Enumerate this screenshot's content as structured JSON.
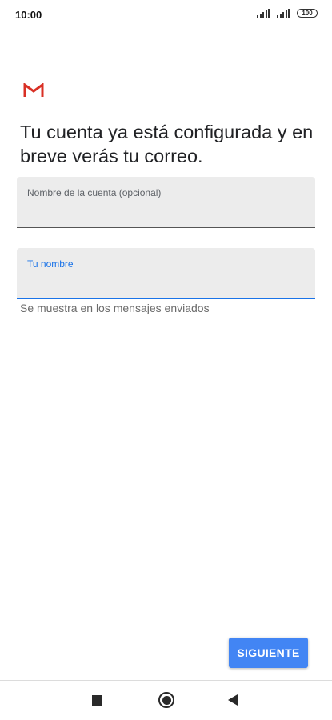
{
  "status_bar": {
    "time": "10:00",
    "battery": "100",
    "icons": [
      "signal-icon",
      "signal-icon",
      "battery-icon"
    ]
  },
  "app": {
    "logo": "gmail-logo",
    "title": "Tu cuenta ya está configurada y en breve verás tu correo."
  },
  "form": {
    "account_name": {
      "label": "Nombre de la cuenta (opcional)",
      "value": ""
    },
    "your_name": {
      "label": "Tu nombre",
      "value": "",
      "helper": "Se muestra en los mensajes enviados"
    }
  },
  "actions": {
    "next_label": "SIGUIENTE"
  },
  "nav_bar": {
    "icons": [
      "recent-apps-icon",
      "home-icon",
      "back-icon"
    ]
  },
  "colors": {
    "accent": "#1a73e8",
    "button": "#4285f4",
    "field_bg": "#ececec",
    "gmail_red": "#d93025"
  }
}
